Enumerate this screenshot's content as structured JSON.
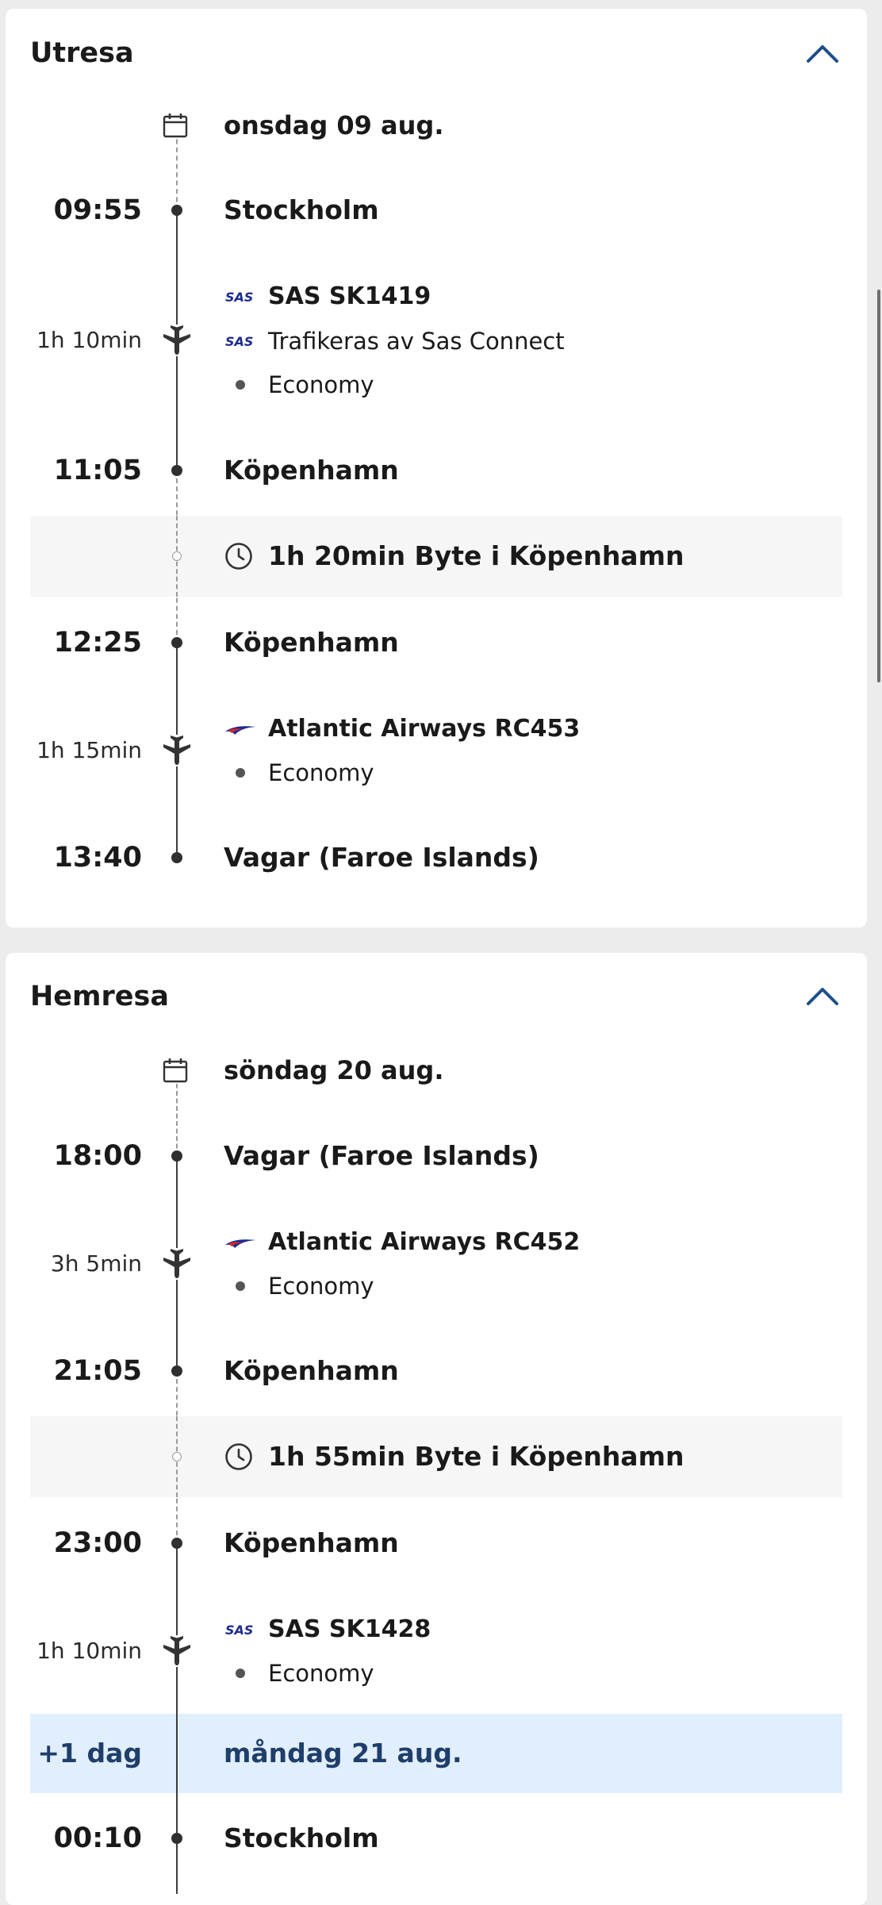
{
  "outbound": {
    "title": "Utresa",
    "date": "onsdag 09 aug.",
    "segments": [
      {
        "dep_time": "09:55",
        "dep_place": "Stockholm",
        "duration": "1h 10min",
        "flight": "SAS SK1419",
        "operated_by": "Trafikeras av Sas Connect",
        "cabin": "Economy",
        "arr_time": "11:05",
        "arr_place": "Köpenhamn"
      },
      {
        "dep_time": "12:25",
        "dep_place": "Köpenhamn",
        "duration": "1h 15min",
        "flight": "Atlantic Airways RC453",
        "cabin": "Economy",
        "arr_time": "13:40",
        "arr_place": "Vagar (Faroe Islands)"
      }
    ],
    "layover": "1h 20min Byte i Köpenhamn"
  },
  "return": {
    "title": "Hemresa",
    "date": "söndag 20 aug.",
    "segments": [
      {
        "dep_time": "18:00",
        "dep_place": "Vagar (Faroe Islands)",
        "duration": "3h 5min",
        "flight": "Atlantic Airways RC452",
        "cabin": "Economy",
        "arr_time": "21:05",
        "arr_place": "Köpenhamn"
      },
      {
        "dep_time": "23:00",
        "dep_place": "Köpenhamn",
        "duration": "1h 10min",
        "flight": "SAS SK1428",
        "cabin": "Economy",
        "arr_time": "00:10",
        "arr_place": "Stockholm"
      }
    ],
    "layover": "1h 55min Byte i Köpenhamn",
    "next_day_label": "+1 dag",
    "next_day_date": "måndag 21 aug."
  },
  "icons": {
    "collapse": "chevron-up-icon",
    "calendar": "calendar-icon",
    "plane": "airplane-icon",
    "clock": "clock-icon",
    "sas_logo": "sas-logo",
    "atlantic_logo": "atlantic-airways-logo"
  },
  "colors": {
    "chevron": "#1f4f8a",
    "sas_blue": "#1d2b8f",
    "next_day_bg": "#e1effc",
    "next_day_text": "#1f3e6a",
    "layover_bg": "#f6f6f6"
  }
}
